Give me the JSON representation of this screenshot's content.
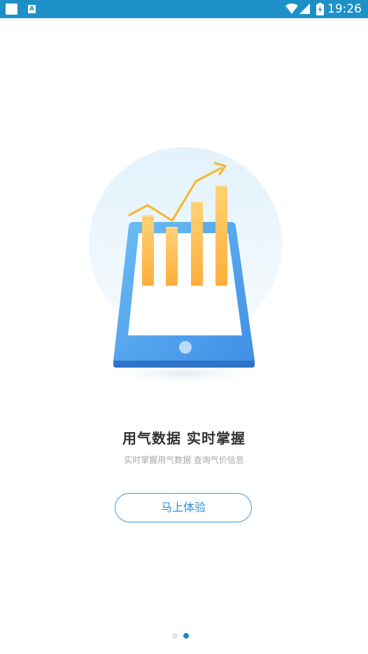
{
  "status_bar": {
    "time": "19:26",
    "icons": [
      "app-square-icon",
      "font-a-icon",
      "wifi-icon",
      "signal-icon",
      "battery-charging-icon"
    ]
  },
  "onboarding": {
    "title": "用气数据  实时掌握",
    "subtitle": "实时掌握用气数据  查询气价信息",
    "cta_label": "马上体验",
    "page_count": 2,
    "current_page": 2
  },
  "colors": {
    "status_bar": "#1e90c8",
    "accent": "#2b8fd8",
    "bar": "#ffbe4d",
    "trend_line": "#f9b62c",
    "tablet": "#4fa7ee"
  }
}
